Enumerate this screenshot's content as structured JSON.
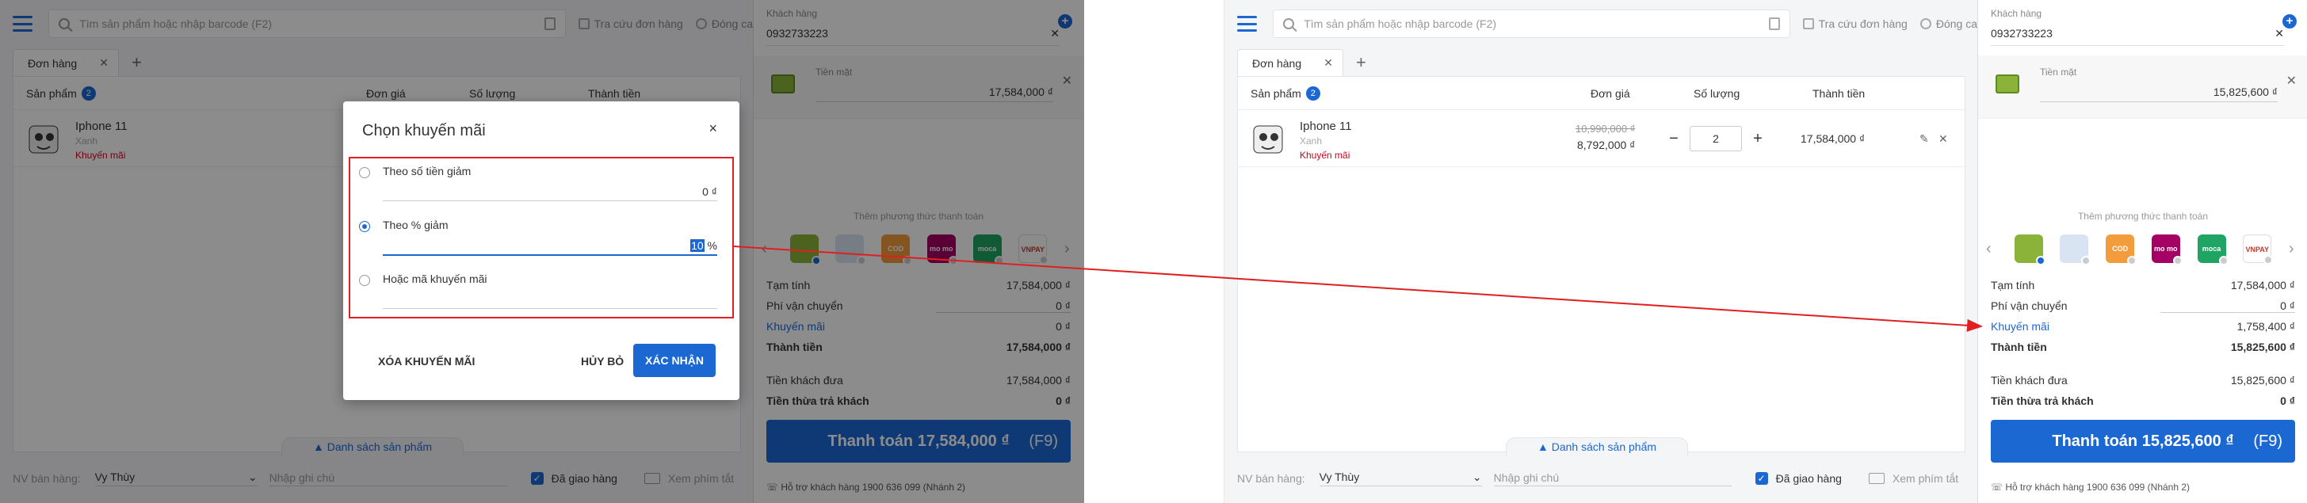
{
  "topbar": {
    "search_placeholder": "Tìm sản phẩm hoặc nhập barcode (F2)",
    "lookup_order": "Tra cứu đơn hàng",
    "close_shift": "Đóng ca"
  },
  "tab": {
    "label": "Đơn hàng",
    "close": "✕",
    "add": "+"
  },
  "table": {
    "header_product": "Sản phẩm",
    "count": "2",
    "header_price": "Đơn giá",
    "header_qty": "Số lượng",
    "header_total": "Thành tiền"
  },
  "product": {
    "name": "Iphone 11",
    "variant": "Xanh",
    "promo": "Khuyến mãi",
    "old_price": "10,990,000 ₫",
    "new_price": "8,792,000 ₫",
    "qty": "2",
    "total": "17,584,000 ₫"
  },
  "list_link": "▲  Danh sách sản phẩm",
  "footer": {
    "staff_label": "NV bán hàng:",
    "staff_value": "Vy Thùy",
    "note_placeholder": "Nhập ghi chú",
    "delivered": "Đã giao hàng",
    "shortcuts": "Xem phím tắt"
  },
  "customer": {
    "label": "Khách hàng",
    "phone": "0932733223"
  },
  "cash": {
    "label": "Tiền mặt"
  },
  "add_payment": "Thêm phương thức thanh toán",
  "payment_methods": [
    {
      "name": "cash",
      "text": "",
      "color": "#8bb33a"
    },
    {
      "name": "bank",
      "text": "",
      "color": "#d9e4f3"
    },
    {
      "name": "cod",
      "text": "COD",
      "color": "#f39c3c"
    },
    {
      "name": "momo",
      "text": "mo mo",
      "color": "#a50064"
    },
    {
      "name": "moca",
      "text": "moca",
      "color": "#1fa463"
    },
    {
      "name": "vnpay",
      "text": "VNPAY",
      "color": "#ffffff"
    }
  ],
  "summary_labels": {
    "subtotal": "Tạm tính",
    "shipping": "Phí vận chuyển",
    "promo": "Khuyến mãi",
    "total": "Thành tiền",
    "paid": "Tiền khách đưa",
    "change": "Tiền thừa trả khách"
  },
  "before": {
    "cash_value": "17,584,000 ₫",
    "subtotal": "17,584,000 ₫",
    "shipping": "0 ₫",
    "promo": "0 ₫",
    "total": "17,584,000 ₫",
    "paid": "17,584,000 ₫",
    "change": "0 ₫",
    "pay_button": "Thanh toán 17,584,000 ₫"
  },
  "after": {
    "cash_value": "15,825,600 ₫",
    "subtotal": "17,584,000 ₫",
    "shipping": "0 ₫",
    "promo": "1,758,400 ₫",
    "total": "15,825,600 ₫",
    "paid": "15,825,600 ₫",
    "change": "0 ₫",
    "pay_button": "Thanh toán 15,825,600 ₫"
  },
  "pay_key": "(F9)",
  "support": "Hỗ trợ khách hàng 1900 636 099 (Nhánh 2)",
  "modal": {
    "title": "Chọn khuyến mãi",
    "close": "×",
    "option_amount": "Theo số tiền giảm",
    "amount_value": "0 ₫",
    "option_percent": "Theo % giảm",
    "percent_value": "10",
    "percent_unit": "%",
    "option_code": "Hoặc mã khuyến mãi",
    "clear_button": "XÓA KHUYẾN MÃI",
    "cancel_button": "HỦY BỎ",
    "confirm_button": "XÁC NHẬN"
  }
}
